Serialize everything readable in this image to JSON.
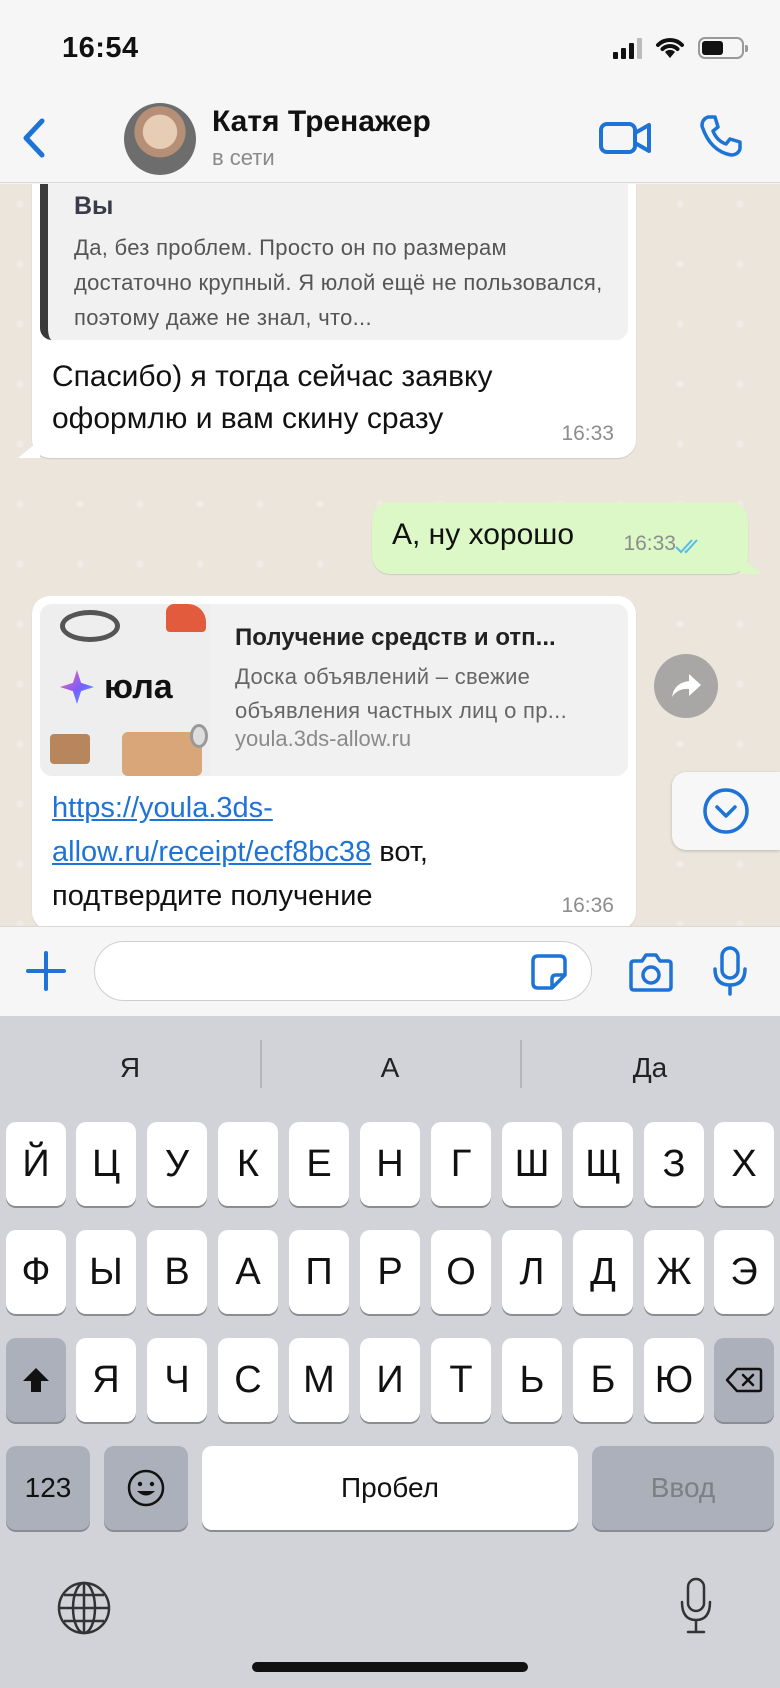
{
  "status_bar": {
    "time": "16:54"
  },
  "header": {
    "contact_name": "Катя Тренажер",
    "contact_status": "в сети"
  },
  "messages": [
    {
      "direction": "incoming",
      "quote": {
        "author": "Вы",
        "text": "Да, без проблем. Просто он по размерам достаточно крупный. Я юлой ещё не пользовался, поэтому даже не знал, что..."
      },
      "text": "Спасибо) я тогда сейчас заявку оформлю и вам скину сразу",
      "time": "16:33"
    },
    {
      "direction": "outgoing",
      "text": "А, ну хорошо",
      "time": "16:33",
      "read": true
    },
    {
      "direction": "incoming",
      "link_preview": {
        "brand": "юла",
        "title": "Получение средств и отп...",
        "description": "Доска объявлений – свежие объявления частных лиц о пр...",
        "domain": "youla.3ds-allow.ru"
      },
      "link": "https://youla.3ds-allow.ru/receipt/ecf8bc38",
      "text_after_link": " вот, подтвердите получение",
      "time": "16:36"
    }
  ],
  "input": {
    "value": "",
    "placeholder": ""
  },
  "keyboard": {
    "predictions": [
      "Я",
      "А",
      "Да"
    ],
    "row1": [
      "Й",
      "Ц",
      "У",
      "К",
      "Е",
      "Н",
      "Г",
      "Ш",
      "Щ",
      "З",
      "Х"
    ],
    "row2": [
      "Ф",
      "Ы",
      "В",
      "А",
      "П",
      "Р",
      "О",
      "Л",
      "Д",
      "Ж",
      "Э"
    ],
    "row3": [
      "Я",
      "Ч",
      "С",
      "М",
      "И",
      "Т",
      "Ь",
      "Б",
      "Ю"
    ],
    "numbers_label": "123",
    "space_label": "Пробел",
    "enter_label": "Ввод"
  },
  "colors": {
    "accent": "#1e73d6",
    "outgoing_bubble": "#dcf8c6",
    "chat_background": "#ebe5dc",
    "read_ticks": "#53bdeb"
  }
}
